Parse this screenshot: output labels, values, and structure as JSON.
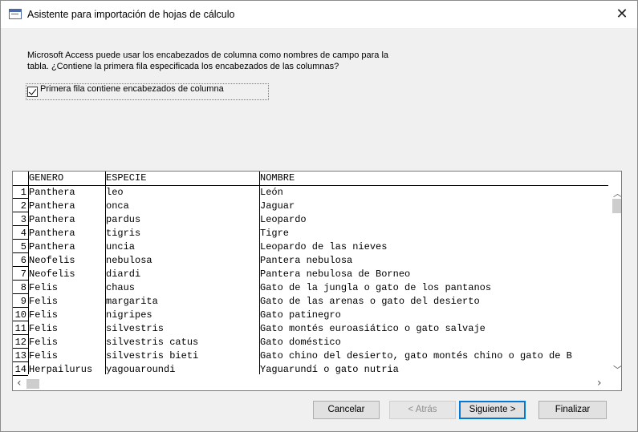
{
  "window": {
    "title": "Asistente para importación de hojas de cálculo",
    "close_glyph": "✕",
    "app_icon": "form-icon"
  },
  "description": {
    "line1": "Microsoft Access puede usar los encabezados de columna como nombres de campo para la",
    "line2": "tabla. ¿Contiene la primera fila especificada los encabezados de las columnas?"
  },
  "first_row_checkbox": {
    "label": "Primera fila contiene encabezados de columna",
    "checked": true
  },
  "grid": {
    "columns": [
      "GENERO",
      "ESPECIE",
      "NOMBRE"
    ],
    "rows": [
      {
        "num": "1",
        "genero": "Panthera",
        "especie": "leo",
        "nombre": "León"
      },
      {
        "num": "2",
        "genero": "Panthera",
        "especie": "onca",
        "nombre": "Jaguar"
      },
      {
        "num": "3",
        "genero": "Panthera",
        "especie": "pardus",
        "nombre": "Leopardo"
      },
      {
        "num": "4",
        "genero": "Panthera",
        "especie": "tigris",
        "nombre": "Tigre"
      },
      {
        "num": "5",
        "genero": "Panthera",
        "especie": "uncia",
        "nombre": "Leopardo de las nieves"
      },
      {
        "num": "6",
        "genero": "Neofelis",
        "especie": "nebulosa",
        "nombre": "Pantera nebulosa"
      },
      {
        "num": "7",
        "genero": "Neofelis",
        "especie": "diardi",
        "nombre": "Pantera nebulosa de Borneo"
      },
      {
        "num": "8",
        "genero": "Felis",
        "especie": "chaus",
        "nombre": "Gato de la jungla o gato de los pantanos"
      },
      {
        "num": "9",
        "genero": "Felis",
        "especie": "margarita",
        "nombre": "Gato de las arenas o gato del desierto"
      },
      {
        "num": "10",
        "genero": "Felis",
        "especie": "nigripes",
        "nombre": "Gato patinegro"
      },
      {
        "num": "11",
        "genero": "Felis",
        "especie": "silvestris",
        "nombre": "Gato montés euroasiático o gato salvaje"
      },
      {
        "num": "12",
        "genero": "Felis",
        "especie": "silvestris catus",
        "nombre": "Gato doméstico"
      },
      {
        "num": "13",
        "genero": "Felis",
        "especie": "silvestris bieti",
        "nombre": "Gato chino del desierto, gato montés chino o gato de B"
      },
      {
        "num": "14",
        "genero": "Herpailurus",
        "especie": "yagouaroundi",
        "nombre": "Yaguarundí o gato nutria"
      }
    ]
  },
  "scroll": {
    "up": "︿",
    "down": "﹀",
    "left": "‹",
    "right": "›"
  },
  "buttons": {
    "cancel": "Cancelar",
    "back": "< Atrás",
    "next": "Siguiente >",
    "finish": "Finalizar"
  }
}
